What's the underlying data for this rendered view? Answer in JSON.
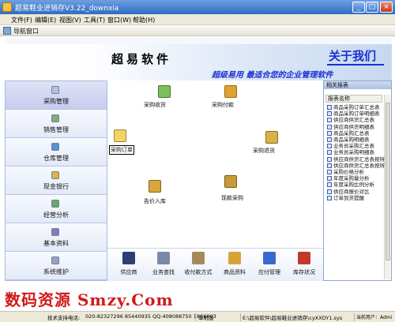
{
  "window": {
    "title": "超易鞋业进销存V3.22_downxia",
    "min_glyph": "_",
    "max_glyph": "□",
    "close_glyph": "×"
  },
  "menubar": {
    "items": [
      {
        "label": "文件(F)"
      },
      {
        "label": "编辑(E)"
      },
      {
        "label": "视图(V)"
      },
      {
        "label": "工具(T)"
      },
      {
        "label": "窗口(W)"
      },
      {
        "label": "帮助(H)"
      }
    ]
  },
  "navbar": {
    "label": "导航窗口"
  },
  "banner": {
    "brand": "超易软件",
    "about": "关于我们",
    "slogan": "超级易用 最适合您的企业管理软件"
  },
  "modules": [
    {
      "label": "采购管理",
      "icon": "purchase-icon",
      "color": "#b8c0d8"
    },
    {
      "label": "销售管理",
      "icon": "sales-icon",
      "color": "#7fb070"
    },
    {
      "label": "仓库管理",
      "icon": "warehouse-icon",
      "color": "#5c8fd6"
    },
    {
      "label": "现金银行",
      "icon": "cash-icon",
      "color": "#e3b33a"
    },
    {
      "label": "经营分析",
      "icon": "analysis-icon",
      "color": "#69a95a"
    },
    {
      "label": "基本资料",
      "icon": "basic-data-icon",
      "color": "#8a7bb0"
    },
    {
      "label": "系统维护",
      "icon": "system-icon",
      "color": "#9aa3b5"
    }
  ],
  "workflow": {
    "items": [
      {
        "label": "采购收货",
        "icon": "receive-goods-icon",
        "color": "#7cc05b"
      },
      {
        "label": "采购付款",
        "icon": "payment-icon",
        "color": "#e0a132"
      },
      {
        "label": "采购订单",
        "icon": "purchase-order-icon",
        "color": "#f0d46a"
      },
      {
        "label": "采购退货",
        "icon": "return-goods-icon",
        "color": "#d9b24a"
      },
      {
        "label": "告价入库",
        "icon": "stock-in-icon",
        "color": "#d8a63e"
      },
      {
        "label": "现款采购",
        "icon": "cash-purchase-icon",
        "color": "#c99a3a"
      }
    ]
  },
  "quickbar": {
    "items": [
      {
        "label": "供应商",
        "icon": "supplier-icon",
        "color": "#2b3f74"
      },
      {
        "label": "业务查找",
        "icon": "search-business-icon",
        "color": "#7a8aa6"
      },
      {
        "label": "收付款方式",
        "icon": "pay-method-icon",
        "color": "#a6895a"
      },
      {
        "label": "商品资料",
        "icon": "goods-data-icon",
        "color": "#d8a23a"
      },
      {
        "label": "应付管理",
        "icon": "payable-icon",
        "color": "#3a6ad0"
      },
      {
        "label": "库存状况",
        "icon": "inventory-icon",
        "color": "#c0392b"
      }
    ]
  },
  "reports": {
    "header": "相关报表",
    "column": "报表名称",
    "items": [
      "商品采购订单汇总表",
      "商品采购订单明细表",
      "供应商供货汇总表",
      "供应商供货明细表",
      "商品采购汇总表",
      "商品采购明细表",
      "业务员采购汇总表",
      "业务员采购明细表",
      "供应商供货汇总表按所",
      "供应商供货汇总表按所",
      "采购价格分析",
      "年度采购量分析",
      "年度采购比例分析",
      "供应商报价对比",
      "订单到货提醒"
    ]
  },
  "watermark": "数码资源 Smzy.Com",
  "statusbar": {
    "support": "技术支持电话:",
    "phones": "020-82327296 85440935 QQ:408088750 1866803",
    "mode": "单机版",
    "path": "E:\\超易软件\\超易鞋业进销存\\cyXXDY1.sys",
    "user": "当前用户：Admi"
  },
  "colors": {
    "titlebar": "#2f6cc2",
    "accent_blue": "#1a2fd0",
    "watermark_red": "#d1191a",
    "active_module": "#c8cbee"
  }
}
